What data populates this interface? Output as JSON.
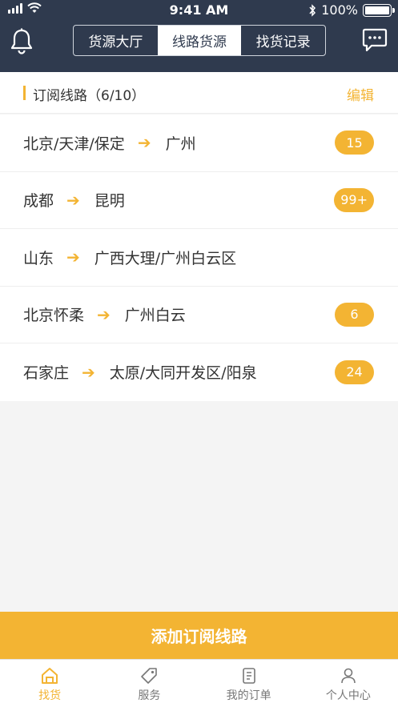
{
  "status_bar": {
    "time": "9:41 AM",
    "battery": "100%",
    "signal_icon": "signal-icon",
    "wifi_icon": "wifi-icon",
    "bluetooth_icon": "bluetooth-icon"
  },
  "header": {
    "left_icon": "bell-icon",
    "right_icon": "chat-icon",
    "tabs": [
      {
        "label": "货源大厅",
        "active": false
      },
      {
        "label": "线路货源",
        "active": true
      },
      {
        "label": "找货记录",
        "active": false
      }
    ]
  },
  "section": {
    "title": "订阅线路（6/10）",
    "edit_label": "编辑"
  },
  "routes": [
    {
      "from": "北京/天津/保定",
      "to": "广州",
      "badge": "15"
    },
    {
      "from": "成都",
      "to": "昆明",
      "badge": "99+"
    },
    {
      "from": "山东",
      "to": "广西大理/广州白云区",
      "badge": ""
    },
    {
      "from": "北京怀柔",
      "to": "广州白云",
      "badge": "6"
    },
    {
      "from": "石家庄",
      "to": "太原/大同开发区/阳泉",
      "badge": "24"
    }
  ],
  "arrow_glyph": "➔",
  "add_button": "添加订阅线路",
  "tabbar": [
    {
      "label": "找货",
      "icon": "home-icon",
      "active": true
    },
    {
      "label": "服务",
      "icon": "tag-icon",
      "active": false
    },
    {
      "label": "我的订单",
      "icon": "order-icon",
      "active": false
    },
    {
      "label": "个人中心",
      "icon": "user-icon",
      "active": false
    }
  ],
  "colors": {
    "header_bg": "#2f3a4e",
    "accent": "#f3b433",
    "background": "#f4f4f4"
  }
}
